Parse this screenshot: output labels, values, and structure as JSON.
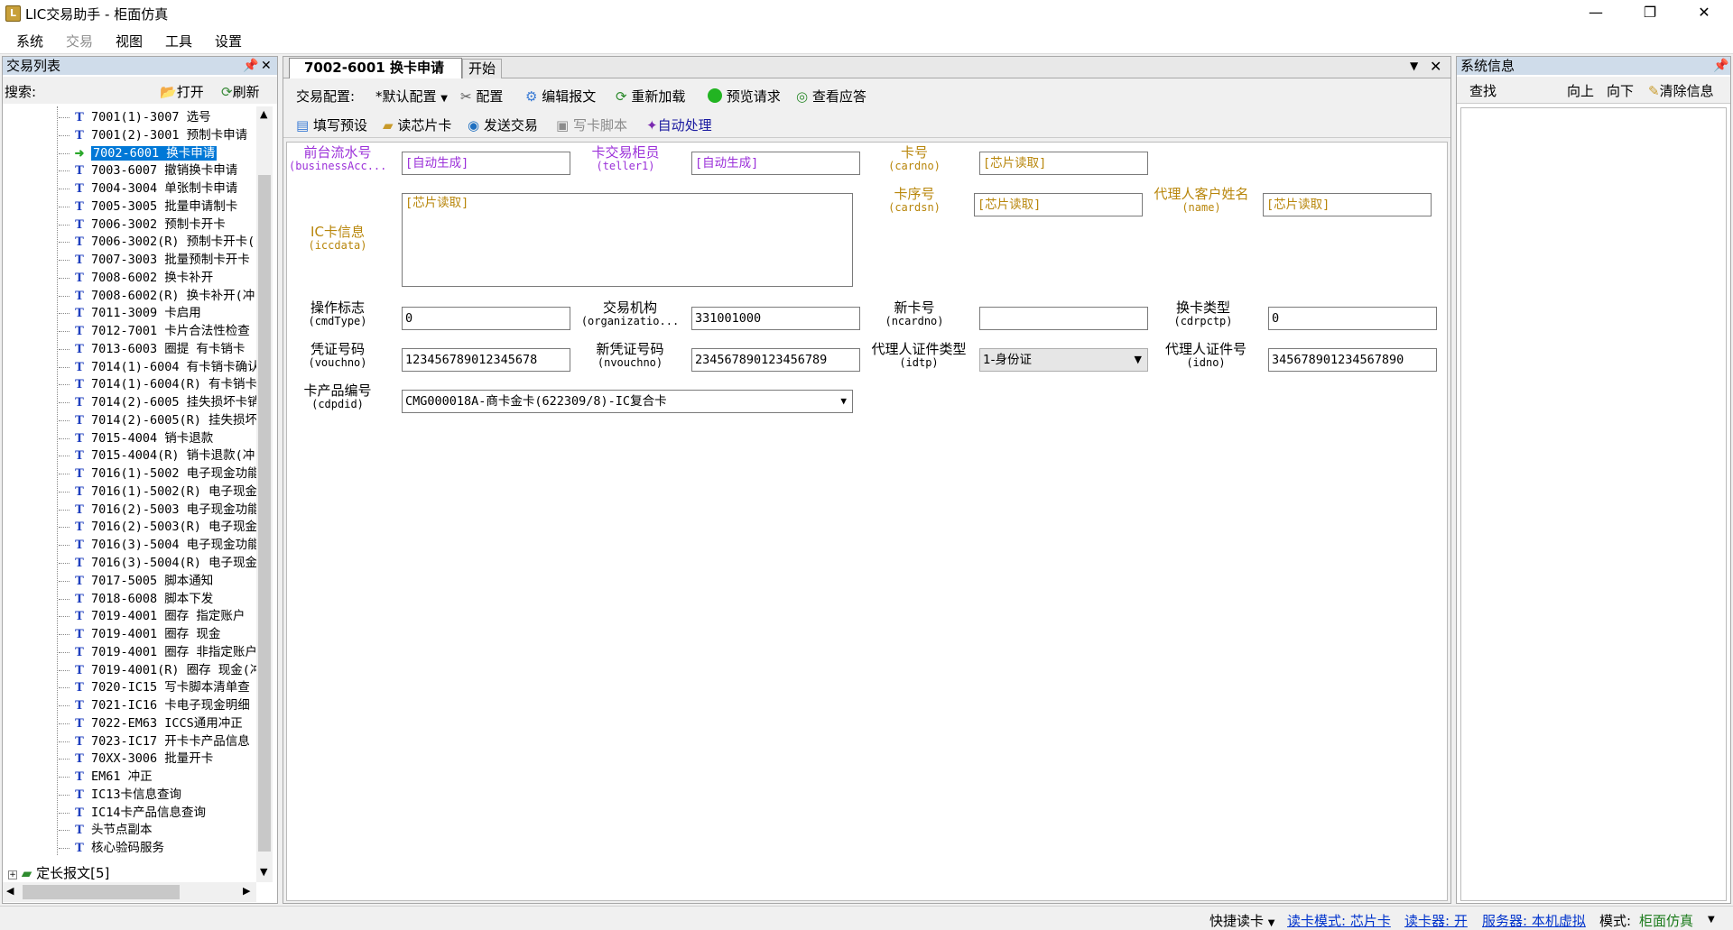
{
  "window": {
    "title": "LIC交易助手 - 柜面仿真",
    "min": "—",
    "restore": "❐",
    "close": "✕"
  },
  "menu": [
    "系统",
    "交易",
    "视图",
    "工具",
    "设置"
  ],
  "left_panel": {
    "title": "交易列表",
    "search_label": "搜索:",
    "open_label": "打开",
    "refresh_label": "刷新",
    "items": [
      "7001(1)-3007 选号",
      "7001(2)-3001 预制卡申请",
      "7002-6001 换卡申请",
      "7003-6007 撤销换卡申请",
      "7004-3004 单张制卡申请",
      "7005-3005 批量申请制卡",
      "7006-3002 预制卡开卡",
      "7006-3002(R) 预制卡开卡(",
      "7007-3003 批量预制卡开卡",
      "7008-6002 换卡补开",
      "7008-6002(R) 换卡补开(冲",
      "7011-3009 卡启用",
      "7012-7001 卡片合法性检查",
      "7013-6003  圈提 有卡销卡",
      "7014(1)-6004 有卡销卡确认",
      "7014(1)-6004(R) 有卡销卡",
      "7014(2)-6005 挂失损坏卡销",
      "7014(2)-6005(R) 挂失损坏",
      "7015-4004 销卡退款",
      "7015-4004(R) 销卡退款(冲",
      "7016(1)-5002 电子现金功能",
      "7016(1)-5002(R) 电子现金",
      "7016(2)-5003 电子现金功能",
      "7016(2)-5003(R) 电子现金",
      "7016(3)-5004 电子现金功能",
      "7016(3)-5004(R) 电子现金",
      "7017-5005 脚本通知",
      "7018-6008 脚本下发",
      "7019-4001 圈存 指定账户",
      "7019-4001 圈存 现金",
      "7019-4001 圈存 非指定账户",
      "7019-4001(R) 圈存 现金(冲",
      "7020-IC15 写卡脚本清单查",
      "7021-IC16 卡电子现金明细",
      "7022-EM63 ICCS通用冲正",
      "7023-IC17 开卡卡产品信息",
      "70XX-3006 批量开卡",
      "EM61 冲正",
      "IC13卡信息查询",
      "IC14卡产品信息查询",
      "头节点副本",
      "核心验码服务"
    ],
    "folder_label": "定长报文[5]",
    "selected_index": 2
  },
  "center": {
    "tabs": [
      "7002-6001 换卡申请",
      "开始"
    ],
    "toolbar1": {
      "config_label": "交易配置:",
      "config_value": "*默认配置",
      "config_btn": "配置",
      "edit_btn": "编辑报文",
      "reload_btn": "重新加载",
      "preview_btn": "预览请求",
      "view_btn": "查看应答"
    },
    "toolbar2": {
      "fill_btn": "填写预设",
      "read_btn": "读芯片卡",
      "send_btn": "发送交易",
      "write_btn": "写卡脚本",
      "auto_btn": "自动处理"
    },
    "form": {
      "f1": {
        "cn": "前台流水号",
        "en": "(businessAcc...",
        "value": "[自动生成]"
      },
      "f2": {
        "cn": "卡交易柜员",
        "en": "(teller1)",
        "value": "[自动生成]"
      },
      "f3": {
        "cn": "卡号",
        "en": "(cardno)",
        "value": "[芯片读取]"
      },
      "f4": {
        "cn": "IC卡信息",
        "en": "(iccdata)",
        "value": "[芯片读取]"
      },
      "f5": {
        "cn": "卡序号",
        "en": "(cardsn)",
        "value": "[芯片读取]"
      },
      "f6": {
        "cn": "代理人客户姓名",
        "en": "(name)",
        "value": "[芯片读取]"
      },
      "f7": {
        "cn": "操作标志",
        "en": "(cmdType)",
        "value": "0"
      },
      "f8": {
        "cn": "交易机构",
        "en": "(organizatio...",
        "value": "331001000"
      },
      "f9": {
        "cn": "新卡号",
        "en": "(ncardno)",
        "value": ""
      },
      "f10": {
        "cn": "换卡类型",
        "en": "(cdrpctp)",
        "value": "0"
      },
      "f11": {
        "cn": "凭证号码",
        "en": "(vouchno)",
        "value": "123456789012345678"
      },
      "f12": {
        "cn": "新凭证号码",
        "en": "(nvouchno)",
        "value": "234567890123456789"
      },
      "f13": {
        "cn": "代理人证件类型",
        "en": "(idtp)",
        "value": "1-身份证"
      },
      "f14": {
        "cn": "代理人证件号",
        "en": "(idno)",
        "value": "345678901234567890"
      },
      "f15": {
        "cn": "卡产品编号",
        "en": "(cdpdid)",
        "value": "CMG000018A-商卡金卡(622309/8)-IC复合卡"
      }
    }
  },
  "right_panel": {
    "title": "系统信息",
    "find_label": "查找",
    "up_label": "向上",
    "down_label": "向下",
    "clear_label": "清除信息"
  },
  "status": {
    "quick_read": "快捷读卡",
    "read_mode": "读卡模式: 芯片卡",
    "reader": "读卡器: 开",
    "server": "服务器: 本机虚拟",
    "mode_label": "模式:",
    "mode_value": "柜面仿真"
  },
  "colors": {
    "purple": "#9b30d9",
    "gold": "#b8860b",
    "selection": "#0078d7",
    "panel_head": "#cfdcea"
  }
}
